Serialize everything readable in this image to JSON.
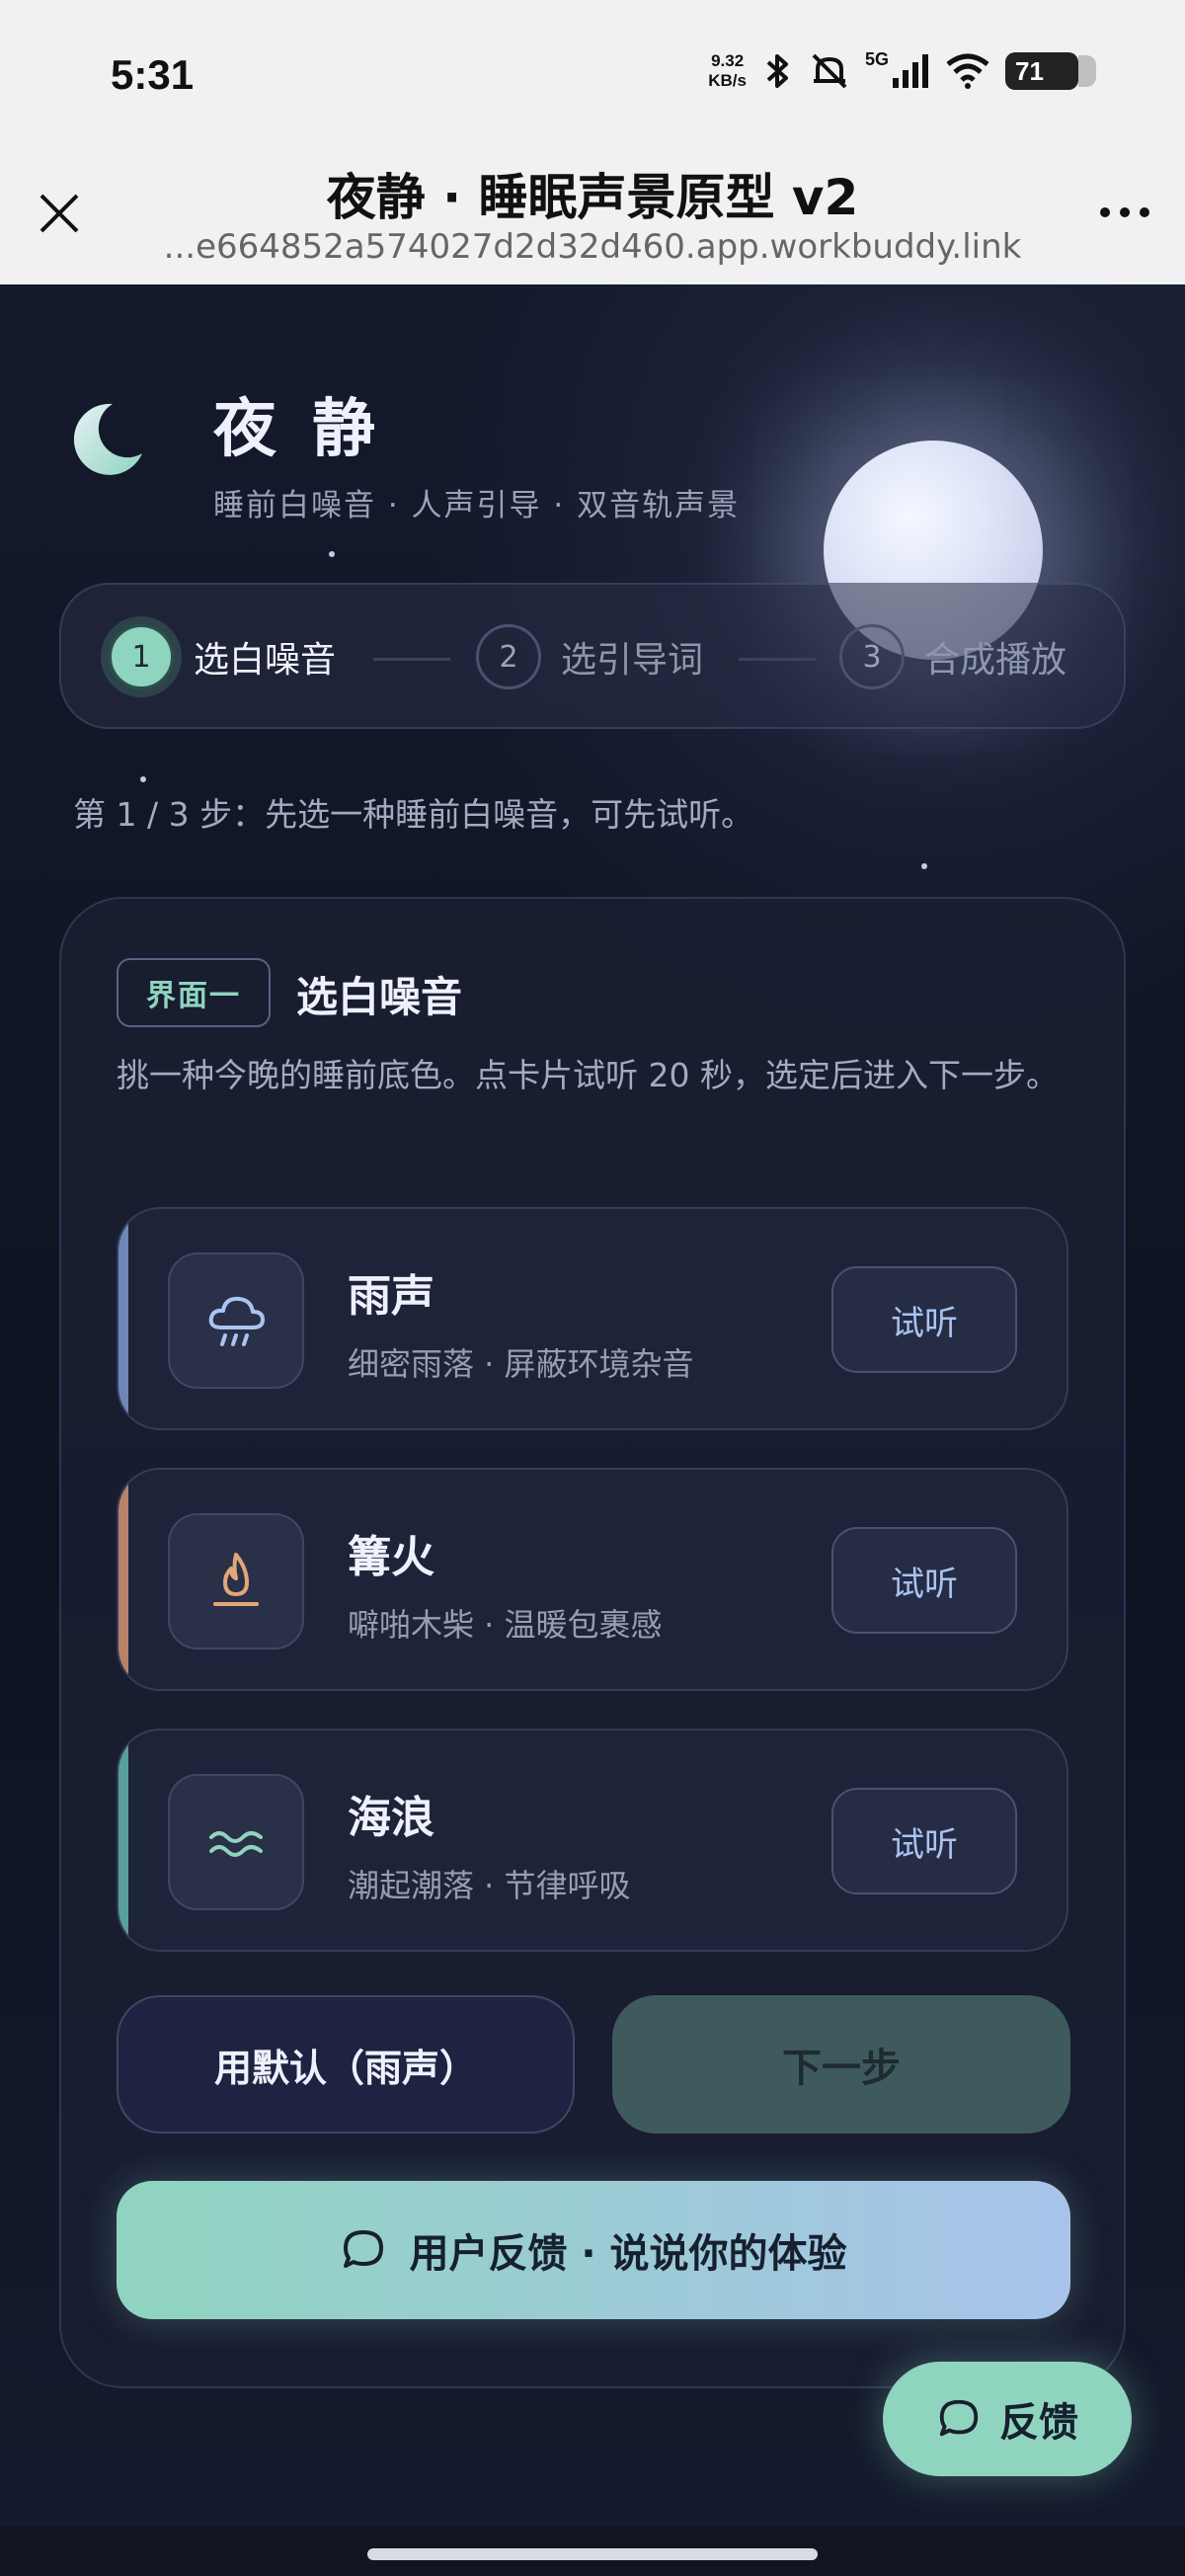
{
  "status_bar": {
    "time": "5:31",
    "speed_value": "9.32",
    "speed_unit": "KB/s",
    "network": "5G",
    "battery": "71"
  },
  "browser": {
    "title": "夜静 · 睡眠声景原型 v2",
    "url": "...e664852a574027d2d32d460.app.workbuddy.link"
  },
  "brand": {
    "title": "夜静",
    "subtitle": "睡前白噪音 · 人声引导 · 双音轨声景"
  },
  "stepper": {
    "steps": [
      {
        "num": "1",
        "label": "选白噪音"
      },
      {
        "num": "2",
        "label": "选引导词"
      },
      {
        "num": "3",
        "label": "合成播放"
      }
    ],
    "active_step": 1
  },
  "hint": "第 1 / 3 步：先选一种睡前白噪音，可先试听。",
  "card": {
    "tag": "界面一",
    "title": "选白噪音",
    "description": "挑一种今晚的睡前底色。点卡片试听 20 秒，选定后进入下一步。",
    "options": [
      {
        "name": "雨声",
        "desc": "细密雨落 · 屏蔽环境杂音",
        "try_label": "试听",
        "icon": "rain-cloud-icon",
        "accent": "#6f86b8"
      },
      {
        "name": "篝火",
        "desc": "噼啪木柴 · 温暖包裹感",
        "try_label": "试听",
        "icon": "campfire-icon",
        "accent": "#b7826a"
      },
      {
        "name": "海浪",
        "desc": "潮起潮落 · 节律呼吸",
        "try_label": "试听",
        "icon": "waves-icon",
        "accent": "#5b9ea0"
      }
    ],
    "default_button": "用默认（雨声）",
    "next_button": "下一步",
    "feedback_button": "用户反馈 · 说说你的体验"
  },
  "fab": {
    "label": "反馈"
  },
  "colors": {
    "accent_mint": "#8fd4bf",
    "accent_blue": "#a7c3ea",
    "background": "#0f1422"
  }
}
